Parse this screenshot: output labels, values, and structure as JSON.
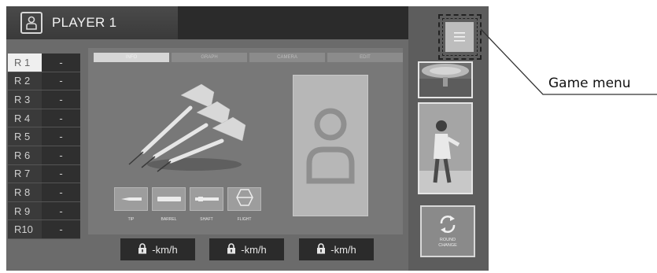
{
  "header": {
    "player_name": "PLAYER 1",
    "avatar_icon": "person-icon"
  },
  "rounds": [
    {
      "label": "R 1",
      "score": "-",
      "active": true
    },
    {
      "label": "R 2",
      "score": "-"
    },
    {
      "label": "R 3",
      "score": "-"
    },
    {
      "label": "R 4",
      "score": "-"
    },
    {
      "label": "R 5",
      "score": "-"
    },
    {
      "label": "R 6",
      "score": "-"
    },
    {
      "label": "R 7",
      "score": "-"
    },
    {
      "label": "R 8",
      "score": "-"
    },
    {
      "label": "R 9",
      "score": "-"
    },
    {
      "label": "R10",
      "score": "-"
    }
  ],
  "tabs": [
    {
      "label": "INFO",
      "active": true
    },
    {
      "label": "GRAPH"
    },
    {
      "label": "CAMERA"
    },
    {
      "label": "EDIT"
    }
  ],
  "parts": [
    {
      "label": "TIP",
      "icon": "tip-icon"
    },
    {
      "label": "BARREL",
      "icon": "barrel-icon"
    },
    {
      "label": "SHAFT",
      "icon": "shaft-icon"
    },
    {
      "label": "FLIGHT",
      "icon": "flight-icon"
    }
  ],
  "speeds": [
    {
      "value": "-km/h",
      "icon": "lock-icon"
    },
    {
      "value": "-km/h",
      "icon": "lock-icon"
    },
    {
      "value": "-km/h",
      "icon": "lock-icon"
    }
  ],
  "round_change": {
    "label": "ROUND CHANGE",
    "icon": "refresh-icon"
  },
  "menu": {
    "icon": "menu-icon"
  },
  "callout": {
    "label": "Game menu"
  }
}
